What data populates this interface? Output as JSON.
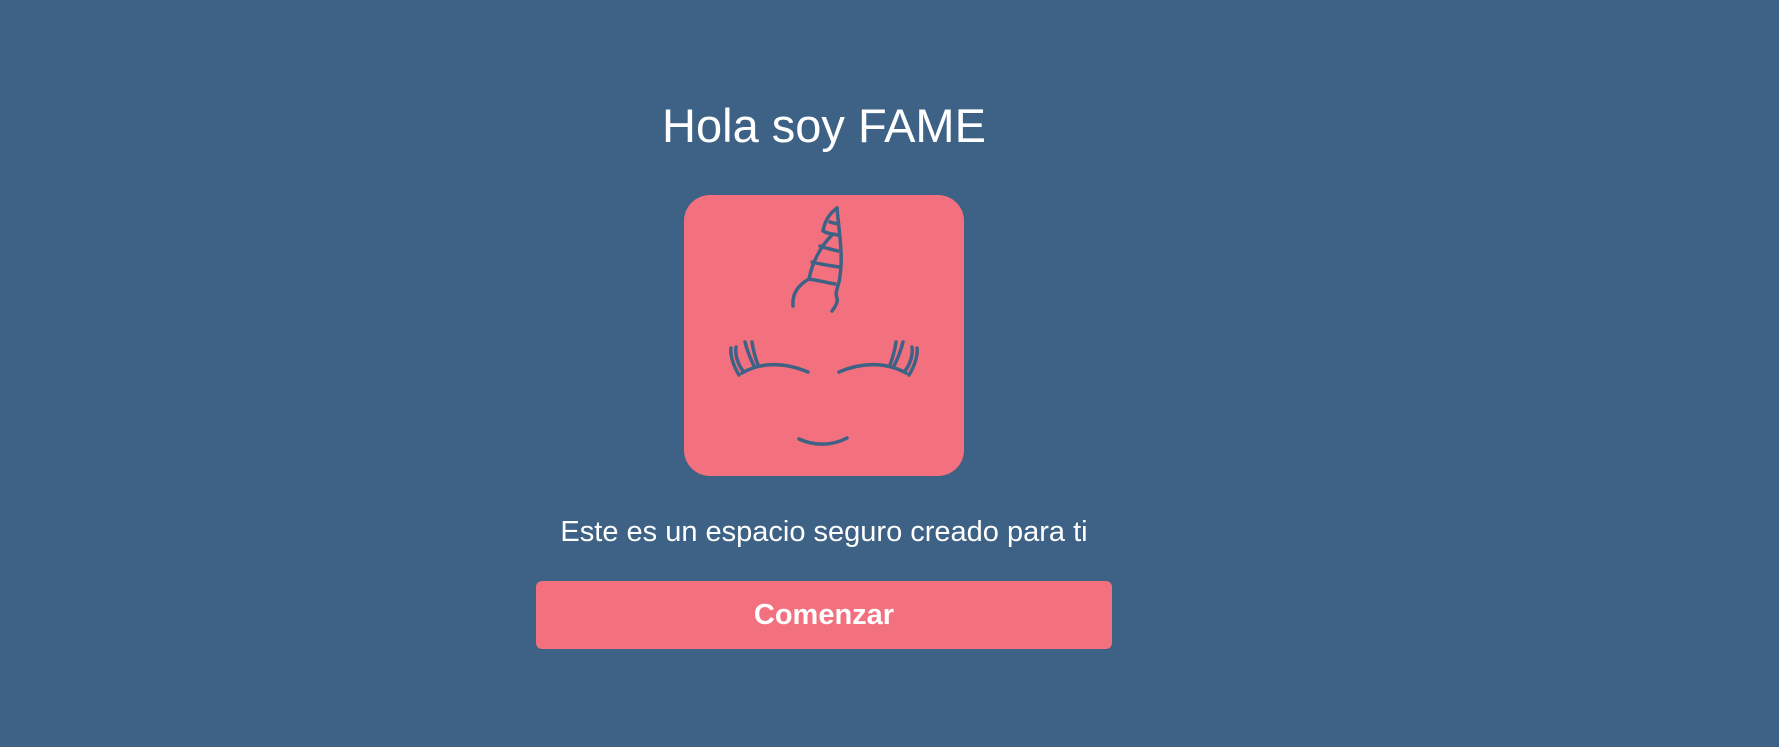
{
  "welcome": {
    "title": "Hola soy FAME",
    "logo_icon": "unicorn-face-icon",
    "subtitle": "Este es un espacio seguro creado para ti",
    "start_button_label": "Comenzar"
  },
  "colors": {
    "background": "#3d6286",
    "accent": "#f3707e",
    "text": "#ffffff"
  }
}
